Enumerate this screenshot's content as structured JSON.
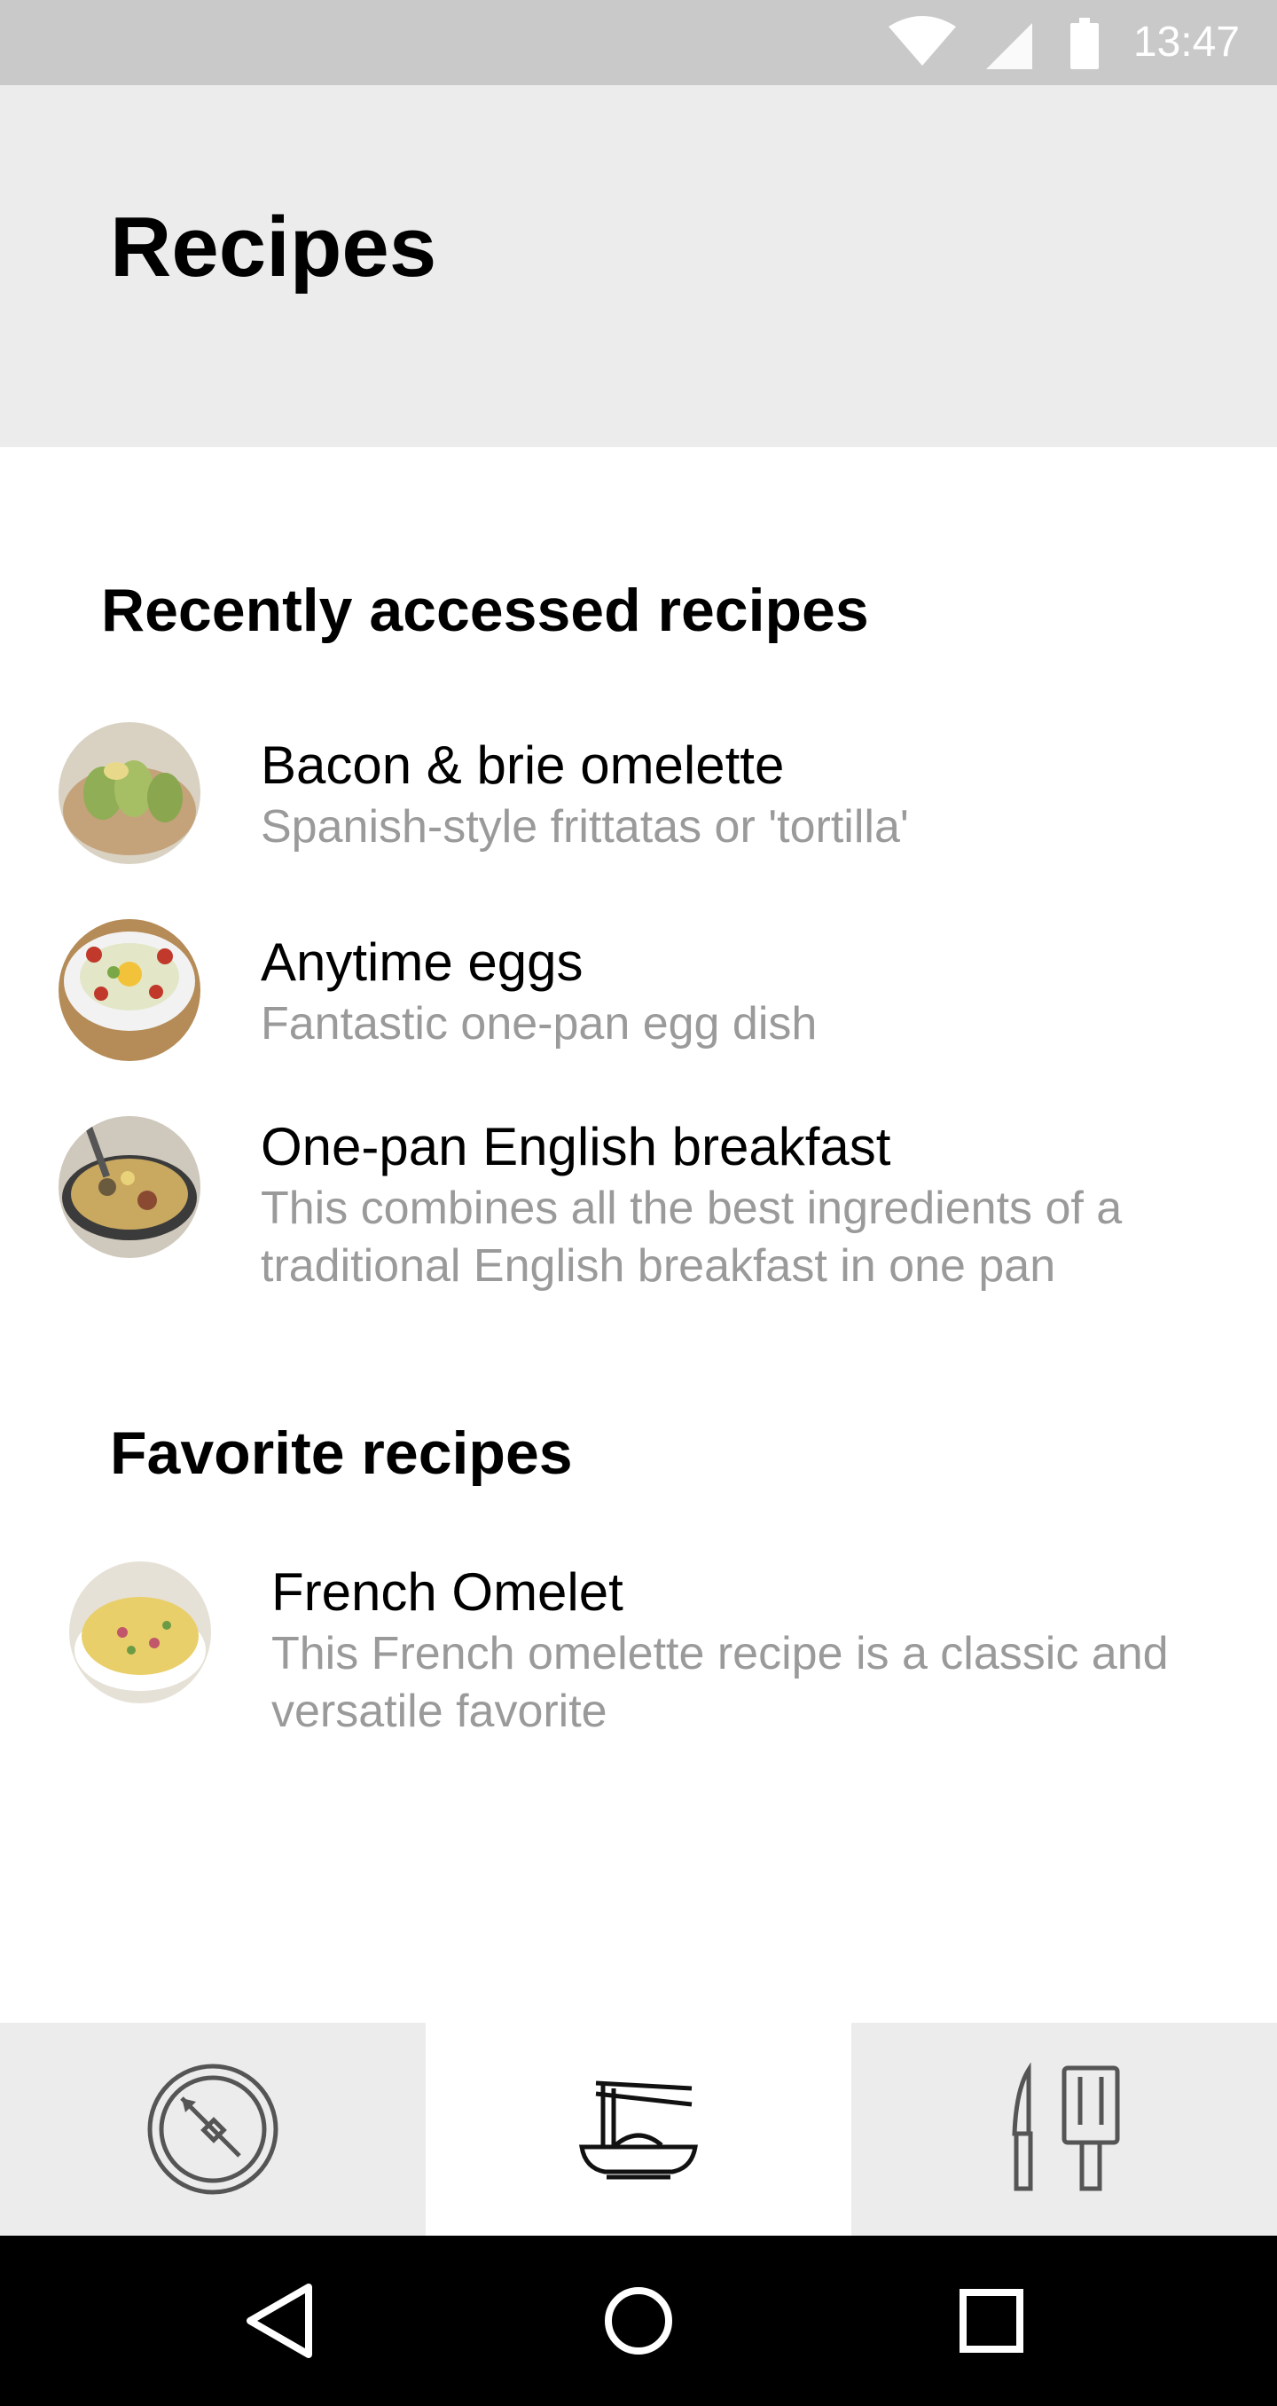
{
  "status_bar": {
    "time": "13:47"
  },
  "header": {
    "title": "Recipes"
  },
  "recent": {
    "title": "Recently accessed recipes",
    "items": [
      {
        "title": "Bacon & brie omelette",
        "description": "Spanish-style frittatas or 'tortilla'"
      },
      {
        "title": "Anytime eggs",
        "description": "Fantastic one-pan egg dish"
      },
      {
        "title": "One-pan English breakfast",
        "description": "This combines all the best ingredients of a traditional English breakfast in one pan"
      }
    ]
  },
  "favorites": {
    "title": "Favorite recipes",
    "items": [
      {
        "title": "French Omelet",
        "description": "This French omelette recipe is a classic and versatile favorite"
      }
    ]
  },
  "bottom_tabs": {
    "items": [
      {
        "icon": "timer-dial-icon"
      },
      {
        "icon": "noodle-bowl-icon",
        "selected": true
      },
      {
        "icon": "knife-spatula-icon"
      }
    ]
  },
  "nav_bar": {
    "buttons": [
      "back-icon",
      "home-icon",
      "recents-icon"
    ]
  },
  "colors": {
    "status_bar": "#c9c9c9",
    "header_bg": "#ececec",
    "description_text": "#9a9a9a",
    "nav_bar": "#000000"
  }
}
